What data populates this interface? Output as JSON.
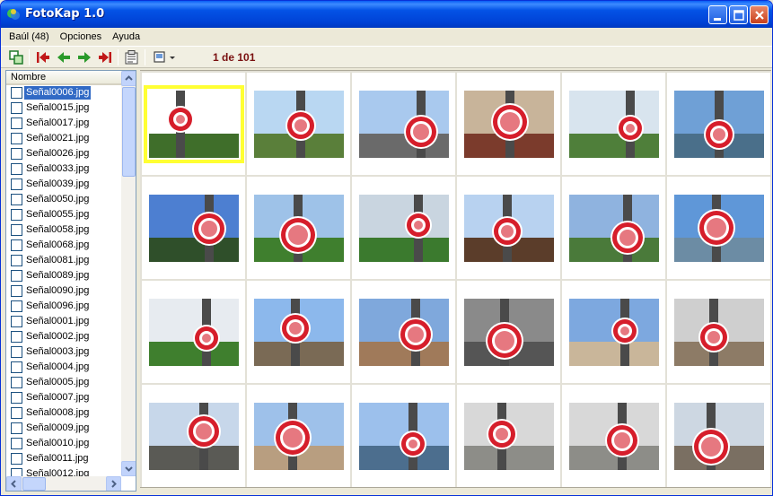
{
  "window": {
    "title": "FotoKap 1.0"
  },
  "menu": [
    "Baúl (48)",
    "Opciones",
    "Ayuda"
  ],
  "toolbar": {
    "counter": "1 de 101"
  },
  "list": {
    "header": "Nombre",
    "selected_index": 0,
    "files": [
      "Señal0006.jpg",
      "Señal0015.jpg",
      "Señal0017.jpg",
      "Señal0021.jpg",
      "Señal0026.jpg",
      "Señal0033.jpg",
      "Señal0039.jpg",
      "Señal0050.jpg",
      "Señal0055.jpg",
      "Señal0058.jpg",
      "Señal0068.jpg",
      "Señal0081.jpg",
      "Señal0089.jpg",
      "Señal0090.jpg",
      "Señal0096.jpg",
      "Señal0001.jpg",
      "Señal0002.jpg",
      "Señal0003.jpg",
      "Señal0004.jpg",
      "Señal0005.jpg",
      "Señal0007.jpg",
      "Señal0008.jpg",
      "Señal0009.jpg",
      "Señal0010.jpg",
      "Señal0011.jpg",
      "Señal0012.jpg"
    ]
  },
  "thumbnails": [
    {
      "sky": "#ffffff",
      "ground": "#3f6e2a",
      "sign": "#d61e2b"
    },
    {
      "sky": "#b9d7f2",
      "ground": "#5a7f3a",
      "sign": "#d61e2b"
    },
    {
      "sky": "#a9c9ee",
      "ground": "#6a6a6a",
      "sign": "#d61e2b"
    },
    {
      "sky": "#c8b49a",
      "ground": "#7b3b2c",
      "sign": "#d61e2b"
    },
    {
      "sky": "#d8e4ee",
      "ground": "#4f7f3a",
      "sign": "#d61e2b"
    },
    {
      "sky": "#6fa0d6",
      "ground": "#4a6f8a",
      "sign": "#d61e2b"
    },
    {
      "sky": "#4d7fd1",
      "ground": "#2f4f2a",
      "sign": "#d61e2b"
    },
    {
      "sky": "#9ec2e8",
      "ground": "#3f7f2e",
      "sign": "#d61e2b"
    },
    {
      "sky": "#c9d5e0",
      "ground": "#3b7a2e",
      "sign": "#d61e2b"
    },
    {
      "sky": "#b8d2f0",
      "ground": "#5b3d2a",
      "sign": "#d61e2b"
    },
    {
      "sky": "#8fb3df",
      "ground": "#4a7a3a",
      "sign": "#d61e2b"
    },
    {
      "sky": "#5f97d8",
      "ground": "#6c8ca4",
      "sign": "#d61e2b"
    },
    {
      "sky": "#e7ebf0",
      "ground": "#3f7f2e",
      "sign": "#d61e2b"
    },
    {
      "sky": "#8cb8ec",
      "ground": "#7a6a55",
      "sign": "#d61e2b"
    },
    {
      "sky": "#7fa8dc",
      "ground": "#a07a5a",
      "sign": "#d61e2b"
    },
    {
      "sky": "#8a8a8a",
      "ground": "#555555",
      "sign": "#d61e2b"
    },
    {
      "sky": "#7da8df",
      "ground": "#c9b69a",
      "sign": "#d61e2b"
    },
    {
      "sky": "#cfcfcf",
      "ground": "#8d7b66",
      "sign": "#d61e2b"
    },
    {
      "sky": "#c7d7ea",
      "ground": "#5a5a55",
      "sign": "#d61e2b"
    },
    {
      "sky": "#9ec1ea",
      "ground": "#b89e80",
      "sign": "#d61e2b"
    },
    {
      "sky": "#9cc0ec",
      "ground": "#4c6e8e",
      "sign": "#d61e2b"
    },
    {
      "sky": "#d8d8d8",
      "ground": "#8d8d88",
      "sign": "#d61e2b"
    },
    {
      "sky": "#d8d8d8",
      "ground": "#8d8d88",
      "sign": "#d61e2b"
    },
    {
      "sky": "#cdd7e2",
      "ground": "#7a6f62",
      "sign": "#d61e2b"
    }
  ]
}
